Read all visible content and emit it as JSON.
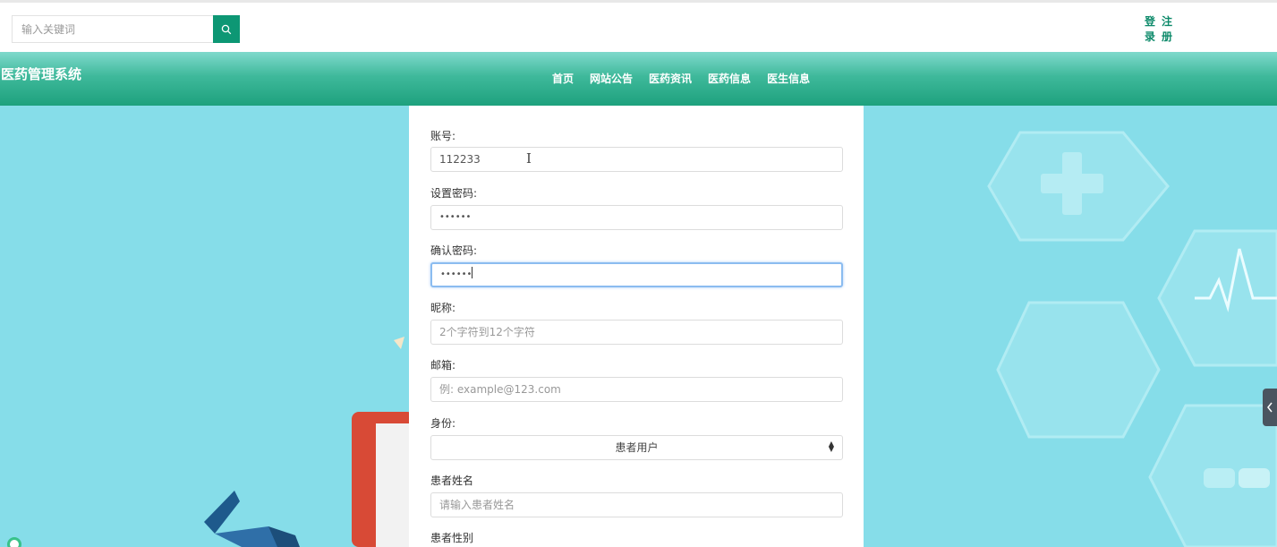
{
  "search": {
    "placeholder": "输入关键词",
    "icon": "search-icon"
  },
  "auth": {
    "login": [
      "登",
      "录"
    ],
    "register": [
      "注",
      "册"
    ]
  },
  "brand": "医药管理系统",
  "nav": [
    "首页",
    "网站公告",
    "医药资讯",
    "医药信息",
    "医生信息"
  ],
  "form": {
    "account": {
      "label": "账号:",
      "value": "112233"
    },
    "password": {
      "label": "设置密码:",
      "value": "••••••"
    },
    "confirm": {
      "label": "确认密码:",
      "value": "••••••"
    },
    "nickname": {
      "label": "昵称:",
      "placeholder": "2个字符到12个字符"
    },
    "email": {
      "label": "邮箱:",
      "placeholder": "例: example@123.com"
    },
    "role": {
      "label": "身份:",
      "selected": "患者用户"
    },
    "patient_name": {
      "label": "患者姓名",
      "placeholder": "请输入患者姓名"
    },
    "patient_gender": {
      "label": "患者性别"
    }
  },
  "colors": {
    "accent": "#0d9774",
    "nav_gradient_top": "#7fd9cc",
    "nav_gradient_bottom": "#1ea17d",
    "background": "#86dde9"
  }
}
